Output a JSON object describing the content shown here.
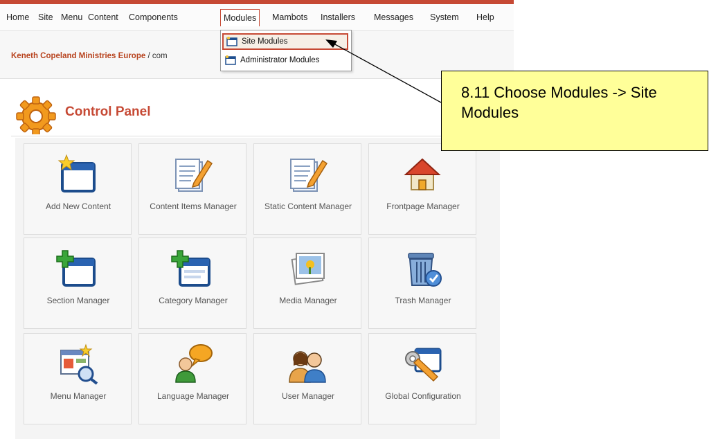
{
  "menu": {
    "items": [
      "Home",
      "Site",
      "Menu",
      "Content",
      "Components",
      "Modules",
      "Mambots",
      "Installers",
      "Messages",
      "System",
      "Help"
    ],
    "active": "Modules"
  },
  "dropdown": {
    "items": [
      "Site Modules",
      "Administrator Modules"
    ],
    "highlighted": "Site Modules"
  },
  "pathway": {
    "site_name": "Keneth Copeland Ministries Europe",
    "rest": " / com"
  },
  "control_panel": {
    "title": "Control Panel"
  },
  "tiles": [
    {
      "label": "Add New Content",
      "icon": "add-content-icon"
    },
    {
      "label": "Content Items Manager",
      "icon": "content-items-icon"
    },
    {
      "label": "Static Content Manager",
      "icon": "static-content-icon"
    },
    {
      "label": "Frontpage Manager",
      "icon": "frontpage-icon"
    },
    {
      "label": "Section Manager",
      "icon": "section-icon"
    },
    {
      "label": "Category Manager",
      "icon": "category-icon"
    },
    {
      "label": "Media Manager",
      "icon": "media-icon"
    },
    {
      "label": "Trash Manager",
      "icon": "trash-icon"
    },
    {
      "label": "Menu Manager",
      "icon": "menu-manager-icon"
    },
    {
      "label": "Language Manager",
      "icon": "language-icon"
    },
    {
      "label": "User Manager",
      "icon": "user-icon"
    },
    {
      "label": "Global Configuration",
      "icon": "global-config-icon"
    }
  ],
  "callout": {
    "text": "8.11 Choose Modules -> Site Modules"
  },
  "colors": {
    "accent": "#c64934",
    "callout_bg": "#ffff99"
  }
}
